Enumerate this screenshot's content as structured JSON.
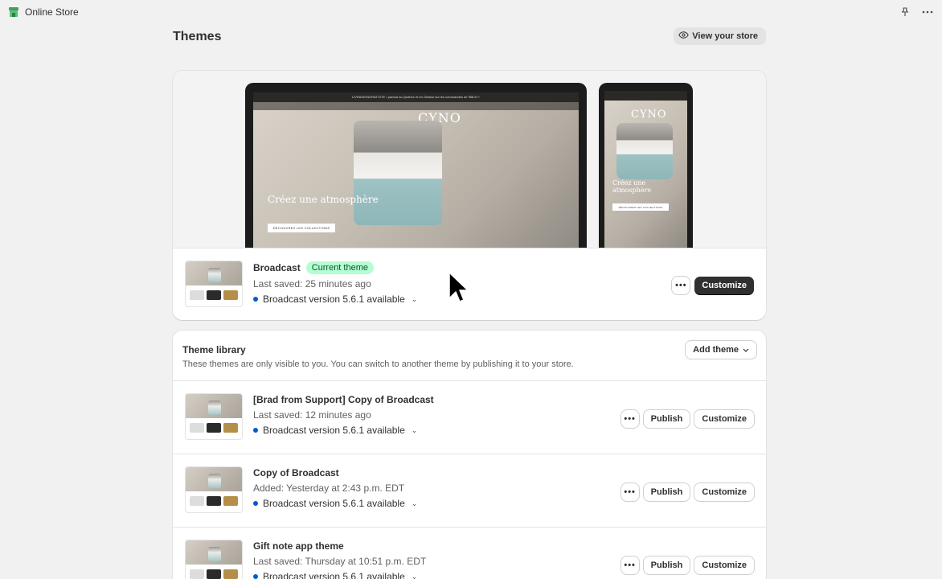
{
  "app": {
    "title": "Online Store"
  },
  "page": {
    "title": "Themes",
    "view_store_label": "View your store"
  },
  "current_theme": {
    "name": "Broadcast",
    "badge": "Current theme",
    "last_saved": "Last saved: 25 minutes ago",
    "version": "Broadcast version 5.6.1 available",
    "customize_label": "Customize",
    "more_label": "•••",
    "preview": {
      "promo_text": "LIVRAISONGRATUITE • partout au Québec et en Ontario sur les commandes de 95$ et +",
      "brand": "CYNO",
      "hero_heading": "Créez une atmosphère",
      "hero_button": "DÉCOUVREZ LES COLLECTIONS",
      "mobile_heading": "Créez une atmosphère",
      "mobile_button": "DÉCOUVREZ LES COLLECTIONS"
    }
  },
  "library": {
    "title": "Theme library",
    "description": "These themes are only visible to you. You can switch to another theme by publishing it to your store.",
    "add_theme_label": "Add theme",
    "themes": [
      {
        "name": "[Brad from Support] Copy of Broadcast",
        "meta": "Last saved: 12 minutes ago",
        "version": "Broadcast version 5.6.1 available",
        "more_label": "•••",
        "publish_label": "Publish",
        "customize_label": "Customize"
      },
      {
        "name": "Copy of Broadcast",
        "meta": "Added: Yesterday at 2:43 p.m. EDT",
        "version": "Broadcast version 5.6.1 available",
        "more_label": "•••",
        "publish_label": "Publish",
        "customize_label": "Customize"
      },
      {
        "name": "Gift note app theme",
        "meta": "Last saved: Thursday at 10:51 p.m. EDT",
        "version": "Broadcast version 5.6.1 available",
        "more_label": "•••",
        "publish_label": "Publish",
        "customize_label": "Customize"
      }
    ]
  },
  "icons": {
    "app_logo": "shopify-store-icon",
    "pin": "pin-icon",
    "more": "more-horizontal-icon",
    "eye": "eye-icon",
    "chevron": "chevron-down-icon"
  },
  "colors": {
    "background": "#f1f1f1",
    "card": "#ffffff",
    "badge_bg": "#b4fed2",
    "badge_text": "#0c5132",
    "primary_button": "#303030",
    "version_dot": "#005bd3"
  }
}
